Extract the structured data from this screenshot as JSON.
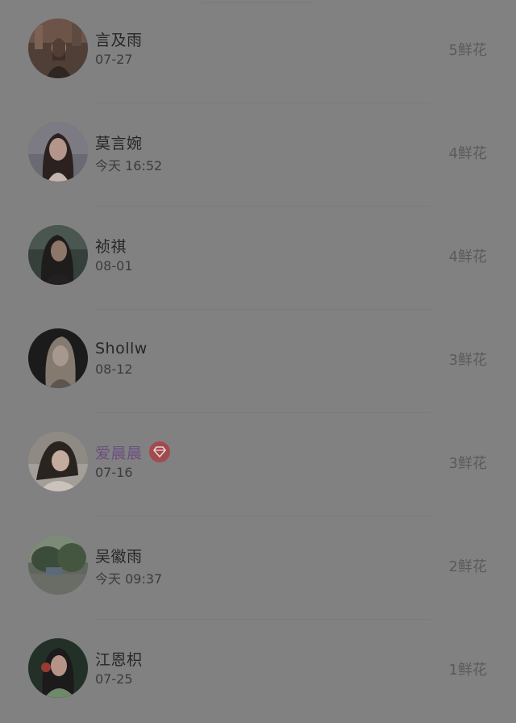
{
  "rows": [
    {
      "name": "言及雨",
      "time": "07-27",
      "flowers": "5鲜花",
      "vip": false
    },
    {
      "name": "莫言婉",
      "time": "今天 16:52",
      "flowers": "4鲜花",
      "vip": false
    },
    {
      "name": "祯祺",
      "time": "08-01",
      "flowers": "4鲜花",
      "vip": false
    },
    {
      "name": "Shollw",
      "time": "08-12",
      "flowers": "3鲜花",
      "vip": false
    },
    {
      "name": "爱晨晨",
      "time": "07-16",
      "flowers": "3鲜花",
      "vip": true
    },
    {
      "name": "吴徽雨",
      "time": "今天 09:37",
      "flowers": "2鲜花",
      "vip": false
    },
    {
      "name": "江恩枳",
      "time": "07-25",
      "flowers": "1鲜花",
      "vip": false
    }
  ],
  "colors": {
    "overlay_background": "#818181",
    "vip_name": "#6b4f80",
    "vip_badge": "#a34a4f"
  },
  "icons": {
    "vip_badge": "diamond-icon"
  }
}
